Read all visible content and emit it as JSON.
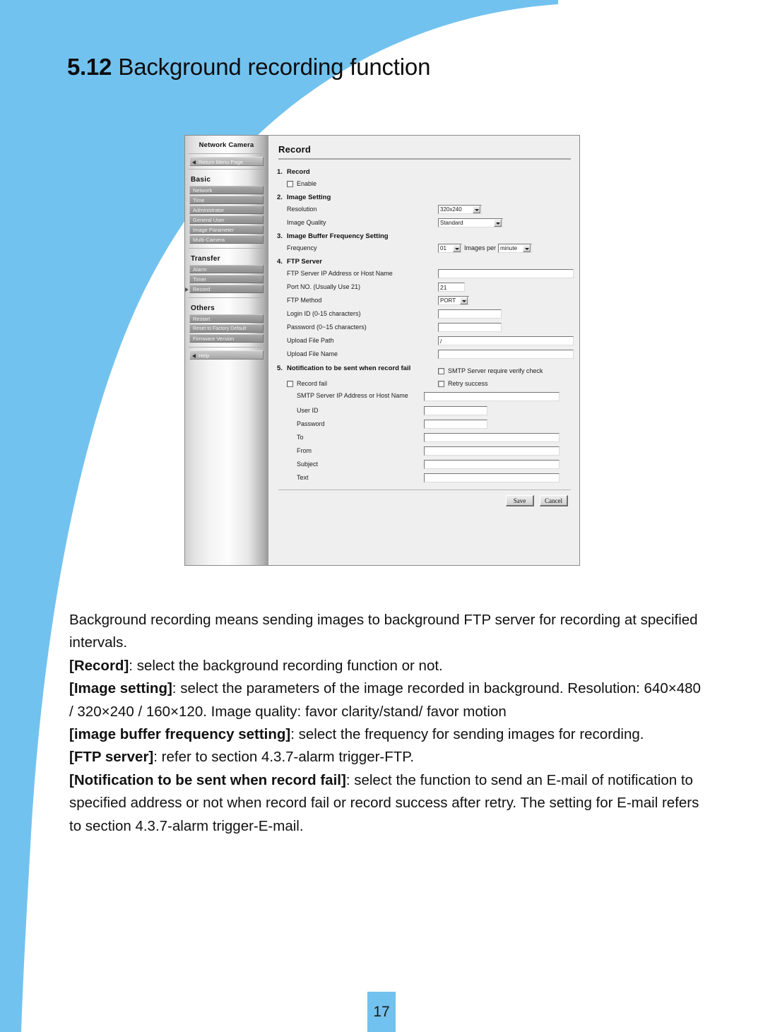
{
  "heading": {
    "section_number": "5.12",
    "title": "Background recording function"
  },
  "colors": {
    "accent_blue": "#72c2ef",
    "page_background": "#ffffff",
    "ui_background": "#efefef"
  },
  "screenshot": {
    "sidebar": {
      "brand": "Network Camera",
      "return_link": "Return Menu Page",
      "help_link": "Help",
      "groups": [
        {
          "title": "Basic",
          "items": [
            "Network",
            "Time",
            "Administrator",
            "General User",
            "Image Parameter",
            "Multi-Camera"
          ]
        },
        {
          "title": "Transfer",
          "items": [
            "Alarm",
            "Timer",
            "Record"
          ],
          "selected": "Record"
        },
        {
          "title": "Others",
          "items": [
            "Restart",
            "Reset to Factory Default",
            "Firmware Version"
          ]
        }
      ]
    },
    "content": {
      "title": "Record",
      "sections": {
        "record": {
          "number": "1.",
          "heading": "Record",
          "enable_label": "Enable",
          "enable_checked": false
        },
        "image_setting": {
          "number": "2.",
          "heading": "Image Setting",
          "resolution_label": "Resolution",
          "resolution_value": "320x240",
          "quality_label": "Image Quality",
          "quality_value": "Standard"
        },
        "buffer_frequency": {
          "number": "3.",
          "heading": "Image Buffer Frequency Setting",
          "frequency_label": "Frequency",
          "frequency_value": "01",
          "middle_text": "Images per",
          "unit_value": "minute"
        },
        "ftp_server": {
          "number": "4.",
          "heading": "FTP Server",
          "host_label": "FTP Server IP Address or Host Name",
          "host_value": "",
          "port_label": "Port NO. (Usually Use 21)",
          "port_value": "21",
          "method_label": "FTP Method",
          "method_value": "PORT",
          "login_label": "Login ID (0-15 characters)",
          "login_value": "",
          "password_label": "Password (0~15 characters)",
          "password_value": "",
          "path_label": "Upload File Path",
          "path_value": "/",
          "filename_label": "Upload File Name",
          "filename_value": ""
        },
        "notification": {
          "number": "5.",
          "heading": "Notification to be sent when record fail",
          "smtp_verify_label": "SMTP Server require verify check",
          "smtp_verify_checked": false,
          "record_fail_label": "Record fail",
          "record_fail_checked": false,
          "retry_success_label": "Retry success",
          "retry_success_checked": false,
          "smtp_host_label": "SMTP Server IP Address or Host Name",
          "smtp_host_value": "",
          "user_id_label": "User ID",
          "user_id_value": "",
          "password_label": "Password",
          "password_value": "",
          "to_label": "To",
          "to_value": "",
          "from_label": "From",
          "from_value": "",
          "subject_label": "Subject",
          "subject_value": "",
          "text_label": "Text",
          "text_value": ""
        }
      },
      "buttons": {
        "save": "Save",
        "cancel": "Cancel"
      }
    }
  },
  "body": {
    "para1": "Background recording means sending images to background FTP server for recording at specified intervals.",
    "para2_label": "[Record]",
    "para2_rest": ": select the background recording function or not.",
    "para3_label": "[Image setting]",
    "para3_rest": ": select the parameters of the image recorded in background. Resolution: 640×480 / 320×240 / 160×120. Image quality: favor clarity/stand/ favor motion",
    "para4_label": "[image buffer frequency setting]",
    "para4_rest": ": select the frequency for sending images for recording.",
    "para5_label": "[FTP server]",
    "para5_rest": ": refer to section 4.3.7-alarm trigger-FTP.",
    "para6_label": "[Notification to be sent when record fail]",
    "para6_rest": ": select the function to send an E-mail of notification to specified address or not when record fail or record success after retry. The setting for E-mail refers to section 4.3.7-alarm trigger-E-mail."
  },
  "footer": {
    "page_number": "17"
  }
}
